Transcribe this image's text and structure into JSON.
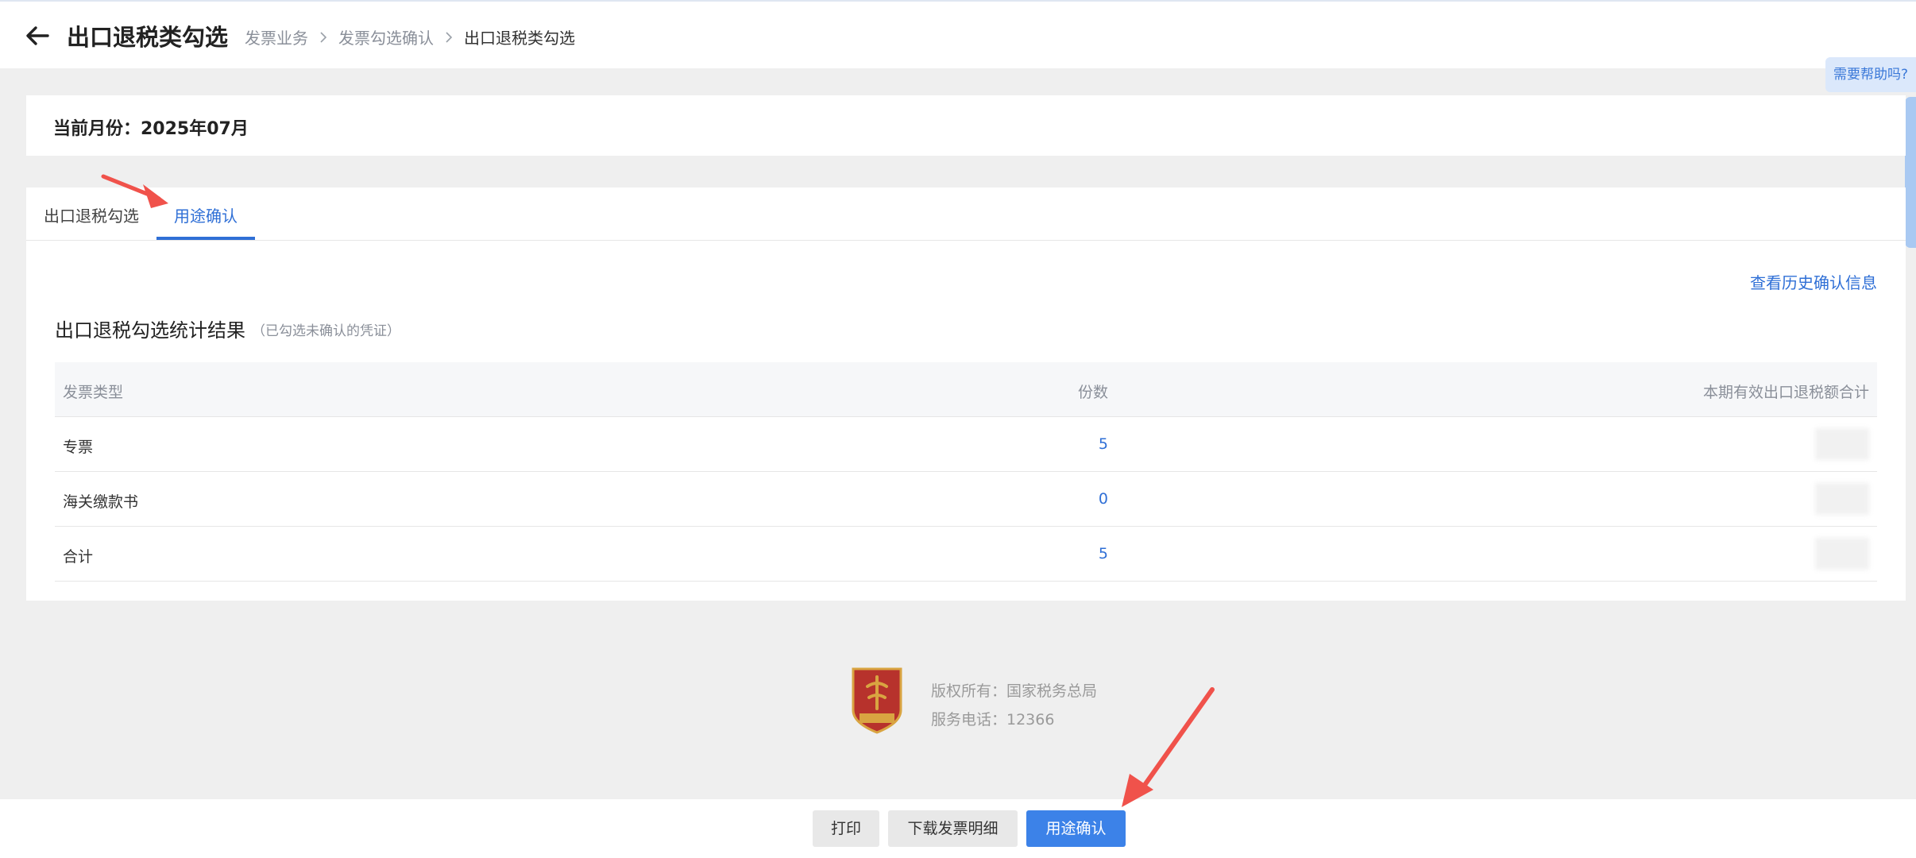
{
  "header": {
    "title": "出口退税类勾选",
    "breadcrumb": [
      "发票业务",
      "发票勾选确认",
      "出口退税类勾选"
    ],
    "help_label": "需要帮助吗?"
  },
  "month": {
    "label": "当前月份：2025年07月"
  },
  "tabs": [
    {
      "label": "出口退税勾选",
      "active": false
    },
    {
      "label": "用途确认",
      "active": true
    }
  ],
  "history_link": "查看历史确认信息",
  "section": {
    "title": "出口退税勾选统计结果",
    "note": "（已勾选未确认的凭证）"
  },
  "table": {
    "headers": [
      "发票类型",
      "份数",
      "本期有效出口退税额合计"
    ],
    "rows": [
      {
        "type": "专票",
        "count": "5"
      },
      {
        "type": "海关缴款书",
        "count": "0"
      },
      {
        "type": "合计",
        "count": "5"
      }
    ]
  },
  "footer": {
    "copyright": "版权所有：国家税务总局",
    "phone": "服务电话：12366"
  },
  "buttons": {
    "print": "打印",
    "download": "下载发票明细",
    "confirm": "用途确认"
  },
  "colors": {
    "accent": "#2f6fd6",
    "primary_button": "#3c82e8",
    "annotation_arrow": "#f0524b",
    "logo_red": "#b7322c",
    "logo_gold": "#d9a441"
  }
}
